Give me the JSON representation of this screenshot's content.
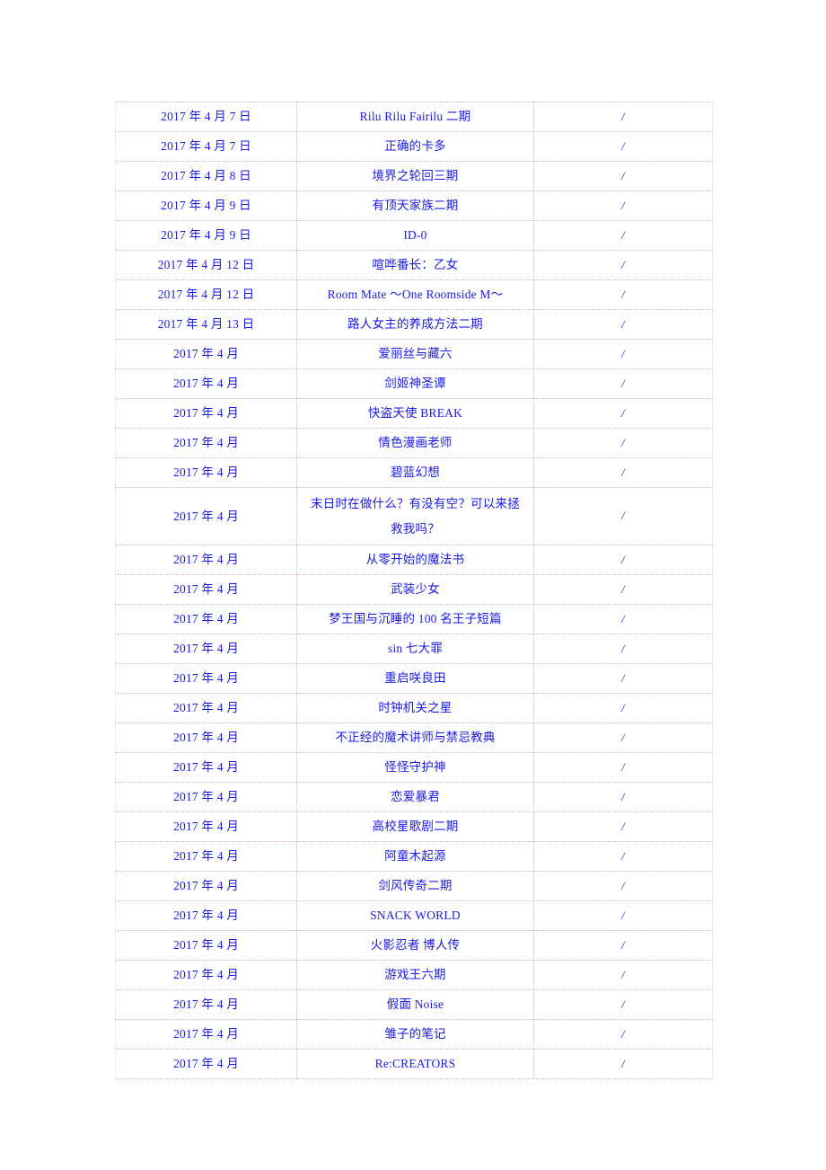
{
  "document": {
    "type": "anime-release-schedule-table",
    "text_color": "#1a1ae6",
    "background_color": "#ffffff",
    "columns": [
      "date",
      "title",
      "note"
    ],
    "rows": [
      {
        "date": "2017 年 4 月 7 日",
        "title": "Rilu Rilu Fairilu 二期",
        "note": "/"
      },
      {
        "date": "2017 年 4 月 7 日",
        "title": "正确的卡多",
        "note": "/"
      },
      {
        "date": "2017 年 4 月 8 日",
        "title": "境界之轮回三期",
        "note": "/"
      },
      {
        "date": "2017 年 4 月 9 日",
        "title": "有顶天家族二期",
        "note": "/"
      },
      {
        "date": "2017 年 4 月 9 日",
        "title": "ID-0",
        "note": "/"
      },
      {
        "date": "2017 年 4 月 12 日",
        "title": "喧哗番长：乙女",
        "note": "/"
      },
      {
        "date": "2017 年 4 月 12 日",
        "title": "Room Mate ～One Roomside M～",
        "note": "/"
      },
      {
        "date": "2017 年 4 月 13 日",
        "title": "路人女主的养成方法二期",
        "note": "/"
      },
      {
        "date": "2017 年 4 月",
        "title": "爱丽丝与藏六",
        "note": "/"
      },
      {
        "date": "2017 年 4 月",
        "title": "剑姬神圣谭",
        "note": "/"
      },
      {
        "date": "2017 年 4 月",
        "title": "快盗天使 BREAK",
        "note": "/"
      },
      {
        "date": "2017 年 4 月",
        "title": "情色漫画老师",
        "note": "/"
      },
      {
        "date": "2017 年 4 月",
        "title": "碧蓝幻想",
        "note": "/"
      },
      {
        "date": "2017 年 4 月",
        "title": "末日时在做什么？有没有空？可以来拯救我吗？",
        "note": "/",
        "tall": true
      },
      {
        "date": "2017 年 4 月",
        "title": "从零开始的魔法书",
        "note": "/"
      },
      {
        "date": "2017 年 4 月",
        "title": "武装少女",
        "note": "/"
      },
      {
        "date": "2017 年 4 月",
        "title": "梦王国与沉睡的 100 名王子短篇",
        "note": "/"
      },
      {
        "date": "2017 年 4 月",
        "title": "sin 七大罪",
        "note": "/"
      },
      {
        "date": "2017 年 4 月",
        "title": "重启咲良田",
        "note": "/"
      },
      {
        "date": "2017 年 4 月",
        "title": "时钟机关之星",
        "note": "/"
      },
      {
        "date": "2017 年 4 月",
        "title": "不正经的魔术讲师与禁忌教典",
        "note": "/"
      },
      {
        "date": "2017 年 4 月",
        "title": "怪怪守护神",
        "note": "/"
      },
      {
        "date": "2017 年 4 月",
        "title": "恋爱暴君",
        "note": "/"
      },
      {
        "date": "2017 年 4 月",
        "title": "高校星歌剧二期",
        "note": "/"
      },
      {
        "date": "2017 年 4 月",
        "title": "阿童木起源",
        "note": "/"
      },
      {
        "date": "2017 年 4 月",
        "title": "剑风传奇二期",
        "note": "/"
      },
      {
        "date": "2017 年 4 月",
        "title": "SNACK WORLD",
        "note": "/"
      },
      {
        "date": "2017 年 4 月",
        "title": "火影忍者 博人传",
        "note": "/"
      },
      {
        "date": "2017 年 4 月",
        "title": "游戏王六期",
        "note": "/"
      },
      {
        "date": "2017 年 4 月",
        "title": "假面 Noise",
        "note": "/"
      },
      {
        "date": "2017 年 4 月",
        "title": "雏子的笔记",
        "note": "/"
      },
      {
        "date": "2017 年 4 月",
        "title": "Re:CREATORS",
        "note": "/"
      }
    ]
  }
}
